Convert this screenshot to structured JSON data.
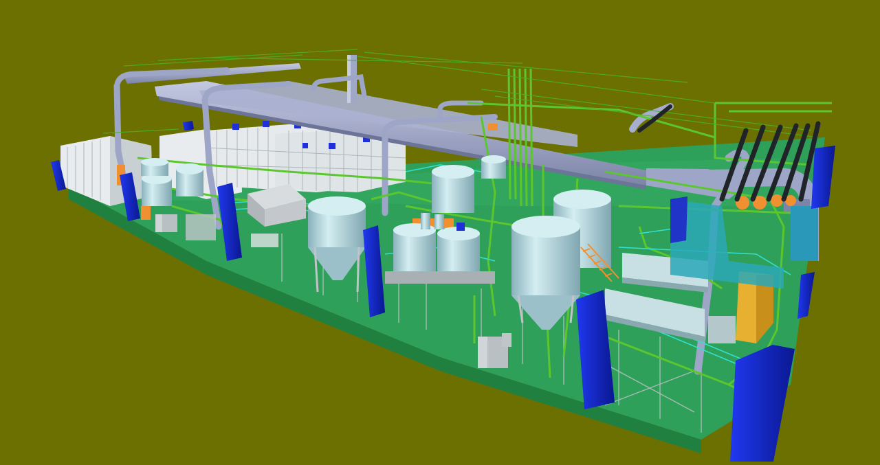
{
  "scene": {
    "subject": "plant-3d-model",
    "colors": {
      "background": "#6b7000",
      "floor": "#2fa05a",
      "floor_dark": "#238a48",
      "column": "#1428d8",
      "column_side": "#0a1890",
      "duct": "#9ea6c8",
      "duct_dark": "#7c84a8",
      "pipe_green": "#5cc62e",
      "pipe_green_dark": "#3c9a1a",
      "cyan_rail": "#30e0d0",
      "tank": "#b0d6de",
      "tank_shade": "#8ab2bc",
      "tank_light": "#d4eef2",
      "equipment_orange": "#f09030",
      "equipment_yellow": "#e8b030",
      "module_white": "#e8ecee",
      "module_grid": "#a8b0b4",
      "black_pipe": "#202428",
      "steel_grey": "#c0c4c8",
      "teal_block": "#2aa8b8"
    }
  }
}
